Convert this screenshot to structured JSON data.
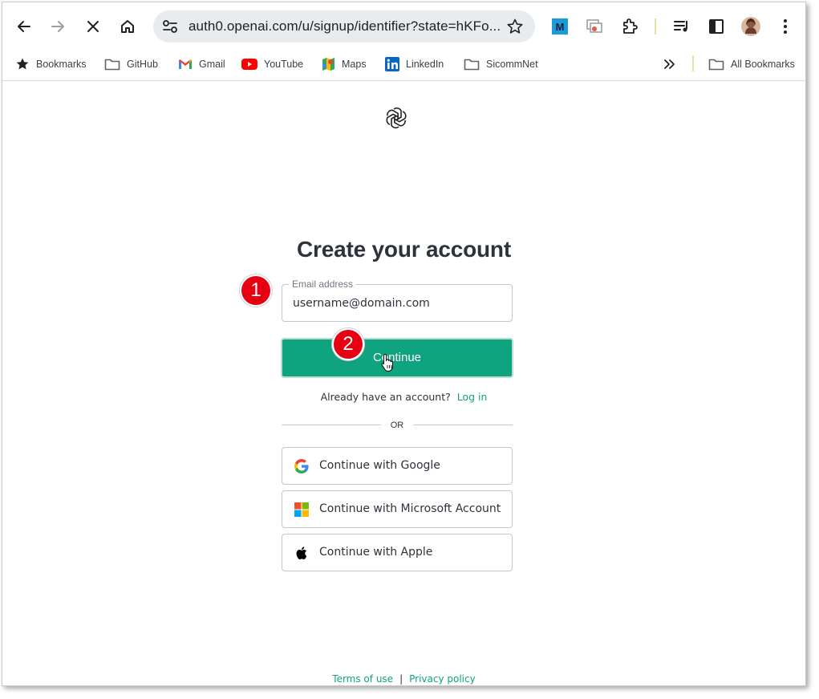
{
  "browser": {
    "url": "auth0.openai.com/u/signup/identifier?state=hKFo...",
    "bookmarks": [
      {
        "label": "Bookmarks",
        "icon": "star-icon"
      },
      {
        "label": "GitHub",
        "icon": "folder-icon"
      },
      {
        "label": "Gmail",
        "icon": "gmail-icon"
      },
      {
        "label": "YouTube",
        "icon": "youtube-icon"
      },
      {
        "label": "Maps",
        "icon": "maps-icon"
      },
      {
        "label": "LinkedIn",
        "icon": "linkedin-icon"
      },
      {
        "label": "SicommNet",
        "icon": "folder-icon"
      }
    ],
    "all_bookmarks_label": "All Bookmarks"
  },
  "signup": {
    "title": "Create your account",
    "email_label": "Email address",
    "email_value": "username@domain.com",
    "continue_label": "Continue",
    "already_text": "Already have an account?",
    "login_link": "Log in",
    "or_text": "OR",
    "social": [
      {
        "label": "Continue with Google",
        "icon": "google-icon"
      },
      {
        "label": "Continue with Microsoft Account",
        "icon": "microsoft-icon"
      },
      {
        "label": "Continue with Apple",
        "icon": "apple-icon"
      }
    ]
  },
  "footer": {
    "terms": "Terms of use",
    "separator": "|",
    "privacy": "Privacy policy"
  },
  "annotations": {
    "step1": "1",
    "step2": "2"
  },
  "colors": {
    "accent": "#10a37f",
    "badge": "#e60012"
  }
}
